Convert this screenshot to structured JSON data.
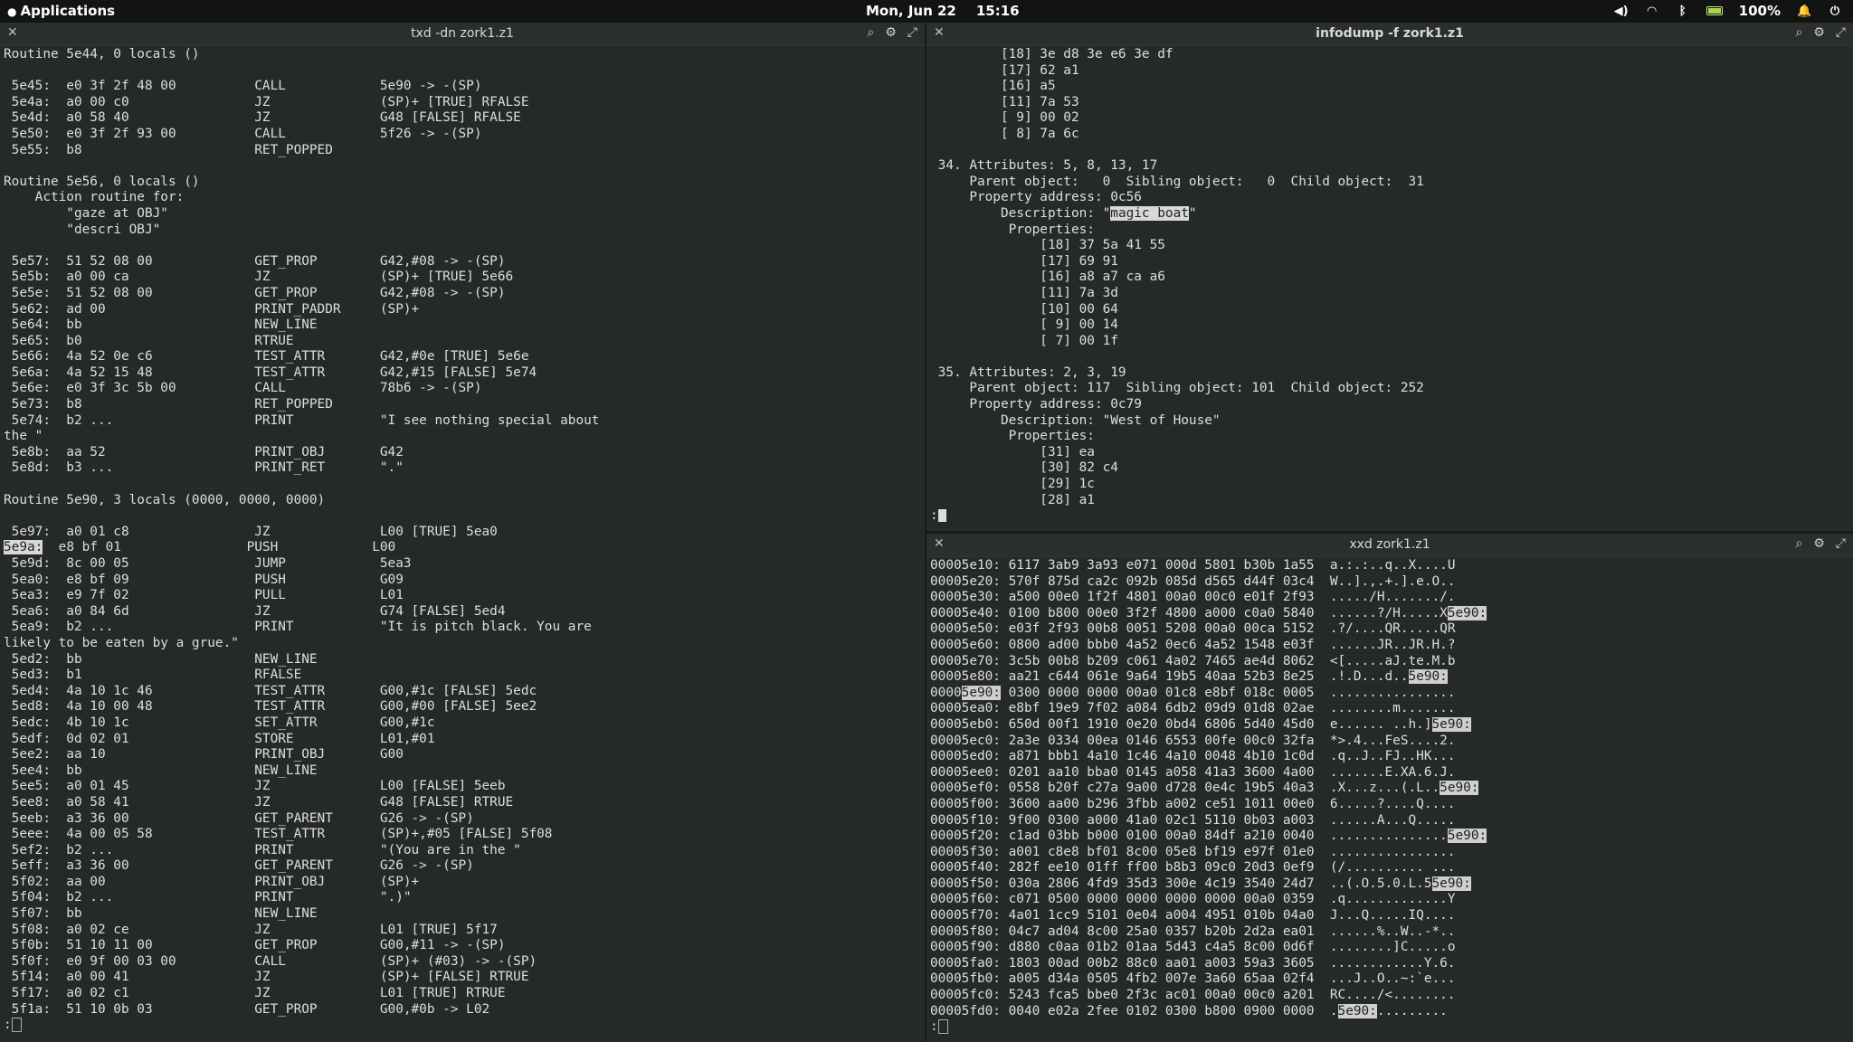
{
  "topbar": {
    "apps_label": "Applications",
    "date": "Mon, Jun 22",
    "time": "15:16",
    "battery": "100%",
    "icons": [
      "volume-icon",
      "wifi-icon",
      "bluetooth-icon",
      "battery-icon",
      "notification-icon",
      "power-icon"
    ]
  },
  "left": {
    "title": "txd -dn zork1.z1",
    "lines": [
      "Routine 5e44, 0 locals ()",
      "",
      " 5e45:  e0 3f 2f 48 00          CALL            5e90 -> -(SP)",
      " 5e4a:  a0 00 c0                JZ              (SP)+ [TRUE] RFALSE",
      " 5e4d:  a0 58 40                JZ              G48 [FALSE] RFALSE",
      " 5e50:  e0 3f 2f 93 00          CALL            5f26 -> -(SP)",
      " 5e55:  b8                      RET_POPPED",
      "",
      "Routine 5e56, 0 locals ()",
      "    Action routine for:",
      "        \"gaze at OBJ\"",
      "        \"descri OBJ\"",
      "",
      " 5e57:  51 52 08 00             GET_PROP        G42,#08 -> -(SP)",
      " 5e5b:  a0 00 ca                JZ              (SP)+ [TRUE] 5e66",
      " 5e5e:  51 52 08 00             GET_PROP        G42,#08 -> -(SP)",
      " 5e62:  ad 00                   PRINT_PADDR     (SP)+",
      " 5e64:  bb                      NEW_LINE",
      " 5e65:  b0                      RTRUE",
      " 5e66:  4a 52 0e c6             TEST_ATTR       G42,#0e [TRUE] 5e6e",
      " 5e6a:  4a 52 15 48             TEST_ATTR       G42,#15 [FALSE] 5e74",
      " 5e6e:  e0 3f 3c 5b 00          CALL            78b6 -> -(SP)",
      " 5e73:  b8                      RET_POPPED",
      " 5e74:  b2 ...                  PRINT           \"I see nothing special about",
      "the \"",
      " 5e8b:  aa 52                   PRINT_OBJ       G42",
      " 5e8d:  b3 ...                  PRINT_RET       \".\"",
      "",
      "Routine 5e90, 3 locals (0000, 0000, 0000)",
      "",
      " 5e97:  a0 01 c8                JZ              L00 [TRUE] 5ea0",
      "@5e9a:  e8 bf 01                PUSH            L00",
      " 5e9d:  8c 00 05                JUMP            5ea3",
      " 5ea0:  e8 bf 09                PUSH            G09",
      " 5ea3:  e9 7f 02                PULL            L01",
      " 5ea6:  a0 84 6d                JZ              G74 [FALSE] 5ed4",
      " 5ea9:  b2 ...                  PRINT           \"It is pitch black. You are",
      "likely to be eaten by a grue.\"",
      " 5ed2:  bb                      NEW_LINE",
      " 5ed3:  b1                      RFALSE",
      " 5ed4:  4a 10 1c 46             TEST_ATTR       G00,#1c [FALSE] 5edc",
      " 5ed8:  4a 10 00 48             TEST_ATTR       G00,#00 [FALSE] 5ee2",
      " 5edc:  4b 10 1c                SET_ATTR        G00,#1c",
      " 5edf:  0d 02 01                STORE           L01,#01",
      " 5ee2:  aa 10                   PRINT_OBJ       G00",
      " 5ee4:  bb                      NEW_LINE",
      " 5ee5:  a0 01 45                JZ              L00 [FALSE] 5eeb",
      " 5ee8:  a0 58 41                JZ              G48 [FALSE] RTRUE",
      " 5eeb:  a3 36 00                GET_PARENT      G26 -> -(SP)",
      " 5eee:  4a 00 05 58             TEST_ATTR       (SP)+,#05 [FALSE] 5f08",
      " 5ef2:  b2 ...                  PRINT           \"(You are in the \"",
      " 5eff:  a3 36 00                GET_PARENT      G26 -> -(SP)",
      " 5f02:  aa 00                   PRINT_OBJ       (SP)+",
      " 5f04:  b2 ...                  PRINT           \".)\"",
      " 5f07:  bb                      NEW_LINE",
      " 5f08:  a0 02 ce                JZ              L01 [TRUE] 5f17",
      " 5f0b:  51 10 11 00             GET_PROP        G00,#11 -> -(SP)",
      " 5f0f:  e0 9f 00 03 00          CALL            (SP)+ (#03) -> -(SP)",
      " 5f14:  a0 00 41                JZ              (SP)+ [FALSE] RTRUE",
      " 5f17:  a0 02 c1                JZ              L01 [TRUE] RTRUE",
      " 5f1a:  51 10 0b 03             GET_PROP        G00,#0b -> L02"
    ],
    "highlight_addr": "5e9a:",
    "prompt": ":"
  },
  "right_top": {
    "title": "infodump -f zork1.z1",
    "lines": [
      "         [18] 3e d8 3e e6 3e df",
      "         [17] 62 a1",
      "         [16] a5",
      "         [11] 7a 53",
      "         [ 9] 00 02",
      "         [ 8] 7a 6c",
      "",
      " 34. Attributes: 5, 8, 13, 17",
      "     Parent object:   0  Sibling object:   0  Child object:  31",
      "     Property address: 0c56",
      "         Description: \"@magic boat\"",
      "          Properties:",
      "              [18] 37 5a 41 55",
      "              [17] 69 91",
      "              [16] a8 a7 ca a6",
      "              [11] 7a 3d",
      "              [10] 00 64",
      "              [ 9] 00 14",
      "              [ 7] 00 1f",
      "",
      " 35. Attributes: 2, 3, 19",
      "     Parent object: 117  Sibling object: 101  Child object: 252",
      "     Property address: 0c79",
      "         Description: \"West of House\"",
      "          Properties:",
      "              [31] ea",
      "              [30] 82 c4",
      "              [29] 1c",
      "              [28] a1"
    ],
    "highlight_text": "magic boat",
    "prompt": ":"
  },
  "right_bottom": {
    "title": "xxd zork1.z1",
    "lines": [
      "00005e10: 6117 3ab9 3a93 e071 000d 5801 b30b 1a55  a.:.:..q..X....U",
      "00005e20: 570f 875d ca2c 092b 085d d565 d44f 03c4  W..].,.+.].e.O..",
      "00005e30: a500 00e0 1f2f 4801 00a0 00c0 e01f 2f93  ...../H......./.",
      "00005e40: 0100 b800 00e0 3f2f 4800 a000 c0a0 5840  ......?/H.....X@",
      "00005e50: e03f 2f93 00b8 0051 5208 00a0 00ca 5152  .?/....QR.....QR",
      "00005e60: 0800 ad00 bbb0 4a52 0ec6 4a52 1548 e03f  ......JR..JR.H.?",
      "00005e70: 3c5b 00b8 b209 c061 4a02 7465 ae4d 8062  <[.....aJ.te.M.b",
      "00005e80: aa21 c644 061e 9a64 19b5 40aa 52b3 8e25  .!.D...d..@.R..%",
      "0000@5e90: 0300 0000 0000 00a0 01c8 e8bf 018c 0005  ................",
      "00005ea0: e8bf 19e9 7f02 a084 6db2 09d9 01d8 02ae  ........m.......",
      "00005eb0: 650d 00f1 1910 0e20 0bd4 6806 5d40 45d0  e...... ..h.]@E.",
      "00005ec0: 2a3e 0334 00ea 0146 6553 00fe 00c0 32fa  *>.4...FeS....2.",
      "00005ed0: a871 bbb1 4a10 1c46 4a10 0048 4b10 1c0d  .q..J..FJ..HK...",
      "00005ee0: 0201 aa10 bba0 0145 a058 41a3 3600 4a00  .......E.XA.6.J.",
      "00005ef0: 0558 b20f c27a 9a00 d728 0e4c 19b5 40a3  .X...z...(.L..@.",
      "00005f00: 3600 aa00 b296 3fbb a002 ce51 1011 00e0  6.....?....Q....",
      "00005f10: 9f00 0300 a000 41a0 02c1 5110 0b03 a003  ......A...Q.....",
      "00005f20: c1ad 03bb b000 0100 00a0 84df a210 0040  ...............@",
      "00005f30: a001 c8e8 bf01 8c00 05e8 bf19 e97f 01e0  ................",
      "00005f40: 282f ee10 01ff ff00 b8b3 09c0 20d3 0ef9  (/.......... ...",
      "00005f50: 030a 2806 4fd9 35d3 300e 4c19 3540 24d7  ..(.O.5.0.L.5@$.",
      "00005f60: c071 0500 0000 0000 0000 0000 00a0 0359  .q.............Y",
      "00005f70: 4a01 1cc9 5101 0e04 a004 4951 010b 04a0  J...Q.....IQ....",
      "00005f80: 04c7 ad04 8c00 25a0 0357 b20b 2d2a ea01  ......%..W..-*..",
      "00005f90: d880 c0aa 01b2 01aa 5d43 c4a5 8c00 0d6f  ........]C.....o",
      "00005fa0: 1803 00ad 00b2 88c0 aa01 a003 59a3 3605  ............Y.6.",
      "00005fb0: a005 d34a 0505 4fb2 007e 3a60 65aa 02f4  ...J..O..~:`e...",
      "00005fc0: 5243 fca5 bbe0 2f3c ac01 00a0 00c0 a201  RC..../<........",
      "00005fd0: 0040 e02a 2fee 0102 0300 b800 0900 0000  .@.*/..........."
    ],
    "highlight_addr": "5e90:",
    "prompt": ":"
  }
}
